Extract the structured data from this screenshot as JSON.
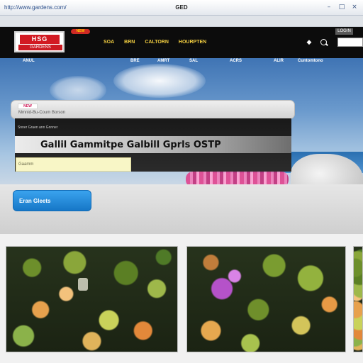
{
  "browser": {
    "url": "http://www.gardens.com/",
    "title": "GED",
    "controls": [
      "–",
      "□",
      "×"
    ]
  },
  "header": {
    "logo_main": "HSG",
    "logo_sub": "GARDENS",
    "badge": "NEW",
    "nav": [
      "SOA",
      "BRN",
      "CALTORN",
      "HOURPTEN"
    ],
    "account_button": "LOGIN",
    "search_placeholder": ""
  },
  "hero": {
    "nav": [
      "ANUL",
      "BRE",
      "AMRT",
      "SAL",
      "ACRS",
      "ALIR",
      "Cuntomtono"
    ],
    "search_tag": "NEW",
    "search_text": "Mmnid-Bu-Coum Borson",
    "headline_meta": "Snner Graen ann Gnnner",
    "headline": "Gallil Gammitpe Galbill Gprls OSTP",
    "headline_pill": "Gaamm",
    "cta_label": "Eran Gleets"
  },
  "gallery": {
    "cards": [
      "garden-1",
      "garden-2",
      "garden-3"
    ]
  },
  "colors": {
    "header_bg": "#0c0c0c",
    "nav_accent": "#f0cc40",
    "logo_red": "#d21a22",
    "cta_blue": "#1677c7"
  }
}
